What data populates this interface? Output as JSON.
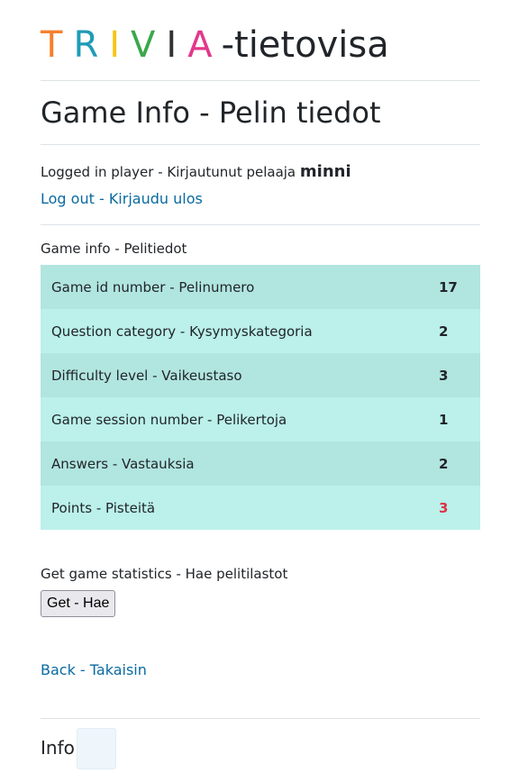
{
  "logo": {
    "letters": [
      {
        "char": "T",
        "color": "#f4812e"
      },
      {
        "char": "R",
        "color": "#1f9bb6"
      },
      {
        "char": "I",
        "color": "#f5c518"
      },
      {
        "char": "V",
        "color": "#3aa84a"
      },
      {
        "char": "I",
        "color": "#333333"
      },
      {
        "char": "A",
        "color": "#e2388b"
      }
    ],
    "suffix": "-tietovisa"
  },
  "page_title": "Game Info - Pelin tiedot",
  "player": {
    "label": "Logged in player - Kirjautunut pelaaja",
    "name": "minni"
  },
  "logout_label": "Log out - Kirjaudu ulos",
  "game_info_label": "Game info - Pelitiedot",
  "rows": [
    {
      "label": "Game id number - Pelinumero",
      "value": "17"
    },
    {
      "label": "Question category - Kysymyskategoria",
      "value": "2"
    },
    {
      "label": "Difficulty level - Vaikeustaso",
      "value": "3"
    },
    {
      "label": "Game session number - Pelikertoja",
      "value": "1"
    },
    {
      "label": "Answers - Vastauksia",
      "value": "2"
    },
    {
      "label": "Points - Pisteitä",
      "value": "3"
    }
  ],
  "stats_label": "Get game statistics - Hae pelitilastot",
  "get_button_label": "Get - Hae",
  "back_label": "Back - Takaisin",
  "info_label": "Info:",
  "colors": {
    "link": "#0a6aa1",
    "points_value": "#dc3545",
    "row_odd": "#b1e5e0",
    "row_even": "#bbf0eb"
  }
}
